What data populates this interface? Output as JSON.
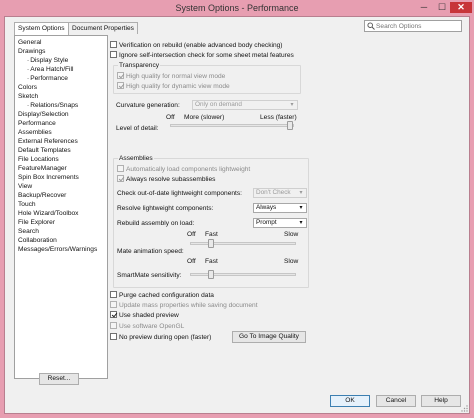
{
  "window": {
    "title": "System Options - Performance",
    "minimize": "─",
    "maximize": "☐",
    "close": "✕"
  },
  "tabs": [
    {
      "label": "System Options",
      "active": true
    },
    {
      "label": "Document Properties",
      "active": false
    }
  ],
  "search": {
    "placeholder": "Search Options"
  },
  "tree": {
    "items": [
      {
        "label": "General",
        "level": 0
      },
      {
        "label": "Drawings",
        "level": 0
      },
      {
        "label": "Display Style",
        "level": 1
      },
      {
        "label": "Area Hatch/Fill",
        "level": 1
      },
      {
        "label": "Performance",
        "level": 1
      },
      {
        "label": "Colors",
        "level": 0
      },
      {
        "label": "Sketch",
        "level": 0
      },
      {
        "label": "Relations/Snaps",
        "level": 1
      },
      {
        "label": "Display/Selection",
        "level": 0
      },
      {
        "label": "Performance",
        "level": 0,
        "selected": true
      },
      {
        "label": "Assemblies",
        "level": 0
      },
      {
        "label": "External References",
        "level": 0
      },
      {
        "label": "Default Templates",
        "level": 0
      },
      {
        "label": "File Locations",
        "level": 0
      },
      {
        "label": "FeatureManager",
        "level": 0
      },
      {
        "label": "Spin Box Increments",
        "level": 0
      },
      {
        "label": "View",
        "level": 0
      },
      {
        "label": "Backup/Recover",
        "level": 0
      },
      {
        "label": "Touch",
        "level": 0
      },
      {
        "label": "Hole Wizard/Toolbox",
        "level": 0
      },
      {
        "label": "File Explorer",
        "level": 0
      },
      {
        "label": "Search",
        "level": 0
      },
      {
        "label": "Collaboration",
        "level": 0
      },
      {
        "label": "Messages/Errors/Warnings",
        "level": 0
      }
    ]
  },
  "options": {
    "verify_rebuild": {
      "label": "Verification on rebuild (enable advanced body checking)",
      "checked": false
    },
    "ignore_self_intersection": {
      "label": "Ignore self-intersection check for some sheet metal features",
      "checked": false
    },
    "transparency": {
      "label": "Transparency",
      "normal": {
        "label": "High quality for normal view mode",
        "checked": true
      },
      "dynamic": {
        "label": "High quality for dynamic view mode",
        "checked": true
      }
    },
    "curvature": {
      "label": "Curvature generation:",
      "value": "Only on demand"
    },
    "level_of_detail": {
      "label": "Level of detail:",
      "off": "Off",
      "more": "More (slower)",
      "less": "Less (faster)",
      "position": 0.97
    },
    "assemblies": {
      "label": "Assemblies",
      "auto_load": {
        "label": "Automatically load components lightweight",
        "checked": false
      },
      "always_resolve": {
        "label": "Always resolve subassemblies",
        "checked": true
      },
      "check_out_of_date": {
        "label": "Check out-of-date lightweight components:",
        "value": "Don't Check"
      },
      "resolve_lightweight": {
        "label": "Resolve lightweight components:",
        "value": "Always"
      },
      "rebuild_on_load": {
        "label": "Rebuild assembly on load:",
        "value": "Prompt"
      },
      "mate_animation": {
        "label": "Mate animation speed:",
        "off": "Off",
        "fast": "Fast",
        "slow": "Slow",
        "position": 0.2
      },
      "smartmate": {
        "label": "SmartMate sensitivity:",
        "off": "Off",
        "fast": "Fast",
        "slow": "Slow",
        "position": 0.2
      }
    },
    "purge_cache": {
      "label": "Purge cached configuration data",
      "checked": false
    },
    "update_mass": {
      "label": "Update mass properties while saving document",
      "checked": false
    },
    "shaded_preview": {
      "label": "Use shaded preview",
      "checked": true
    },
    "software_opengl": {
      "label": "Use software OpenGL",
      "checked": false
    },
    "no_preview": {
      "label": "No preview during open (faster)",
      "checked": false
    },
    "image_quality_button": "Go To Image Quality"
  },
  "buttons": {
    "reset": "Reset...",
    "ok": "OK",
    "cancel": "Cancel",
    "help": "Help"
  }
}
